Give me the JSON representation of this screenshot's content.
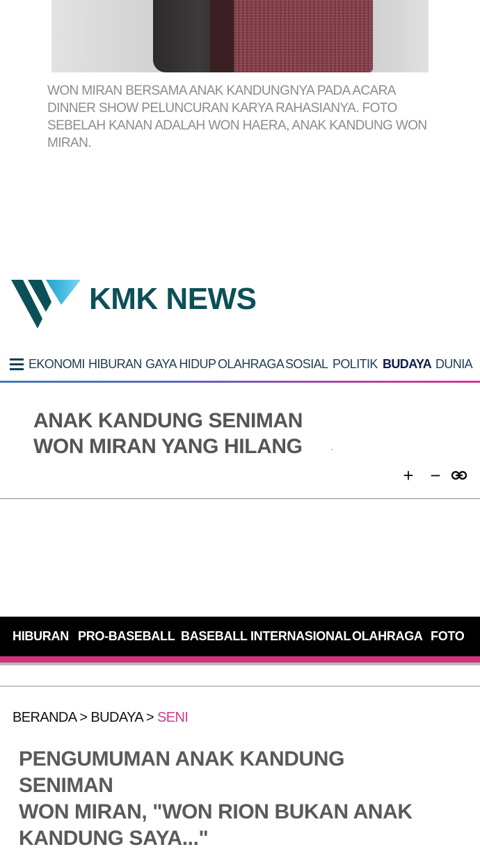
{
  "caption": "WON MIRAN BERSAMA ANAK KANDUNGNYA PADA ACARA DINNER SHOW PELUNCURAN KARYA RAHASIANYA. FOTO SEBELAH KANAN ADALAH WON HAERA, ANAK KANDUNG WON MIRAN.",
  "site": {
    "name": "KMK NEWS",
    "logo_colors": [
      "#0d4f57",
      "#1aa3c9",
      "#6ec9f0"
    ]
  },
  "nav": {
    "menu_icon": "hamburger-icon",
    "items": [
      {
        "label": "EKONOMI",
        "active": false
      },
      {
        "label": "HIBURAN",
        "active": false
      },
      {
        "label": "GAYA HIDUP",
        "active": false
      },
      {
        "label": "OLAHRAGA",
        "active": false
      },
      {
        "label": "SOSIAL",
        "active": false
      },
      {
        "label": "POLITIK",
        "active": false
      },
      {
        "label": "BUDAYA",
        "active": true
      },
      {
        "label": "DUNIA",
        "active": false
      }
    ]
  },
  "article_title": {
    "line1": "ANAK KANDUNG SENIMAN",
    "line2": "WON MIRAN YANG HILANG"
  },
  "tools": {
    "zoom_in": "+",
    "zoom_out": "−",
    "link_icon": "link-icon"
  },
  "category_bar": {
    "items": [
      "HIBURAN",
      "PRO-BASEBALL",
      "BASEBALL INTERNASIONAL",
      "OLAHRAGA",
      "FOTO"
    ],
    "accent": "#d2337f"
  },
  "breadcrumb": {
    "home": "BERANDA",
    "sep": ">",
    "section": "BUDAYA",
    "current": "SENI"
  },
  "headline": {
    "line1": "PENGUMUMAN ANAK KANDUNG SENIMAN",
    "line2": "WON MIRAN, \"WON RION BUKAN ANAK",
    "line3": "KANDUNG SAYA...\""
  }
}
